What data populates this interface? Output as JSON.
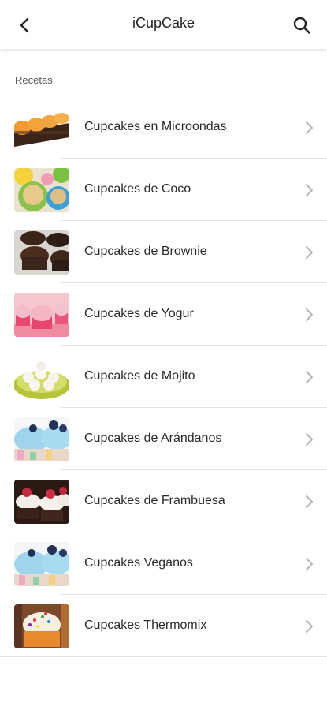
{
  "appbar": {
    "title": "iCupCake",
    "back_icon": "back-arrow-icon",
    "search_icon": "search-icon"
  },
  "section_label": "Recetas",
  "recipes": [
    {
      "label": "Cupcakes en Microondas",
      "thumb": "microwave-cupcakes-photo"
    },
    {
      "label": "Cupcakes de Coco",
      "thumb": "coconut-cupcakes-photo"
    },
    {
      "label": "Cupcakes de Brownie",
      "thumb": "brownie-cupcakes-photo"
    },
    {
      "label": "Cupcakes de Yogur",
      "thumb": "yogurt-cupcakes-photo"
    },
    {
      "label": "Cupcakes de Mojito",
      "thumb": "mojito-cupcakes-photo"
    },
    {
      "label": "Cupcakes de Arándanos",
      "thumb": "blueberry-cupcakes-photo"
    },
    {
      "label": "Cupcakes de Frambuesa",
      "thumb": "raspberry-cupcakes-photo"
    },
    {
      "label": "Cupcakes Veganos",
      "thumb": "vegan-cupcakes-photo"
    },
    {
      "label": "Cupcakes Thermomix",
      "thumb": "thermomix-cupcakes-photo"
    }
  ]
}
